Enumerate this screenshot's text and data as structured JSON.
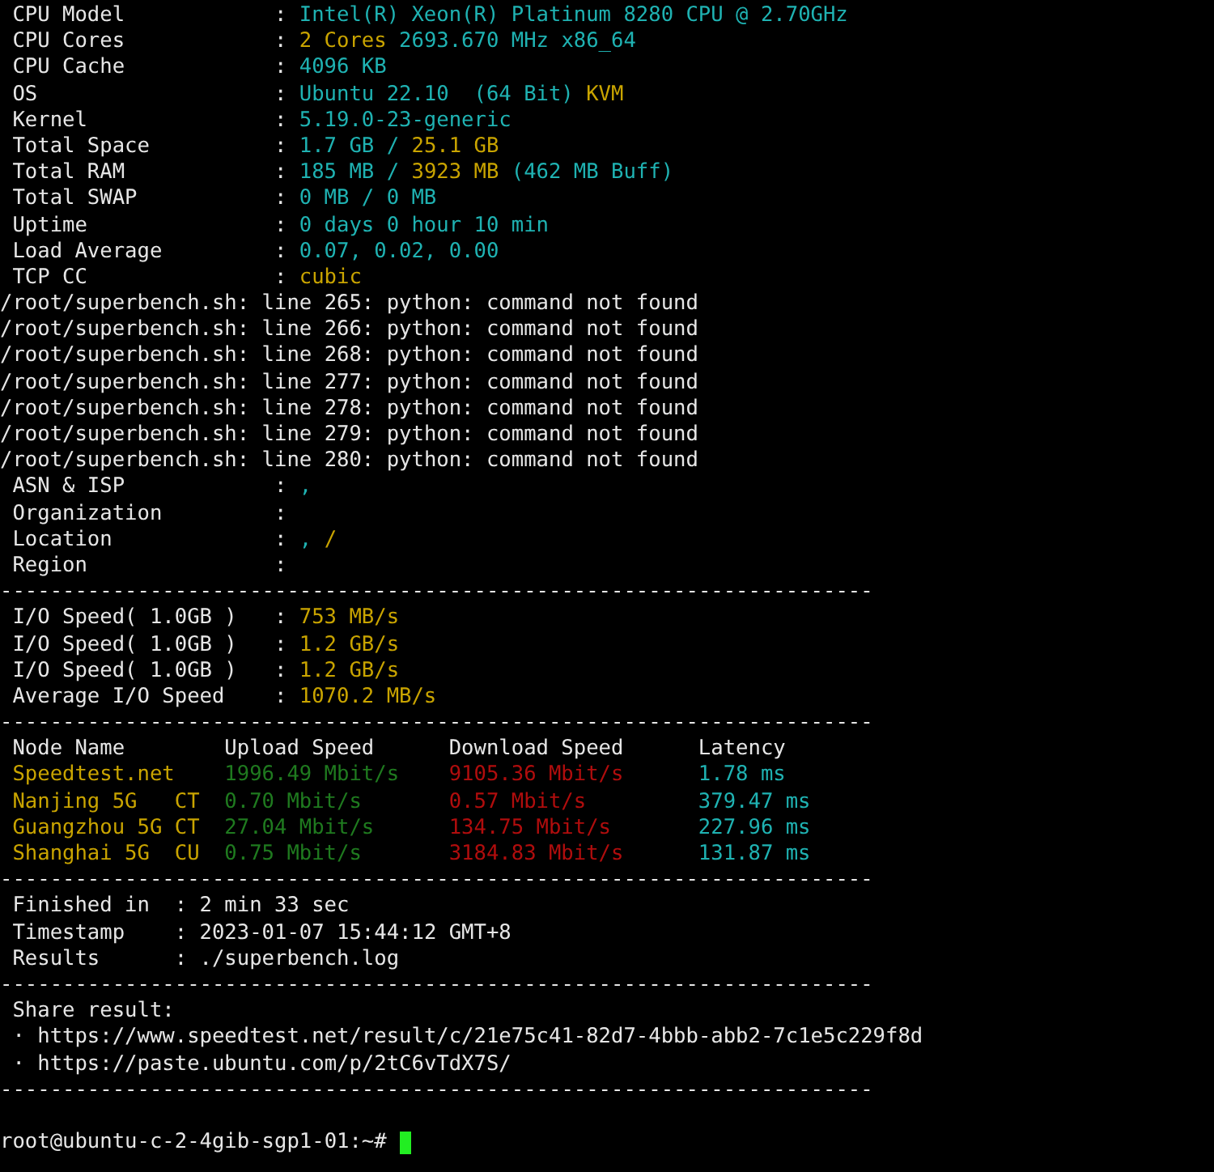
{
  "terminal": {
    "lines": [
      {
        "kind": "field",
        "label": "CPU Model",
        "sep": ":",
        "value": [
          {
            "text": "Intel(R) Xeon(R) Platinum 8280 CPU @ 2.70GHz",
            "color": "#1fb2b2"
          }
        ]
      },
      {
        "kind": "field",
        "label": "CPU Cores",
        "sep": ":",
        "value": [
          {
            "text": "2 Cores",
            "color": "#c9a400"
          },
          {
            "text": "2693.670 MHz x86_64",
            "color": "#1fb2b2"
          }
        ]
      },
      {
        "kind": "field",
        "label": "CPU Cache",
        "sep": ":",
        "value": [
          {
            "text": "4096 KB",
            "color": "#1fb2b2"
          }
        ]
      },
      {
        "kind": "field",
        "label": "OS",
        "sep": ":",
        "value": [
          {
            "text": "Ubuntu 22.10  (64 Bit)",
            "color": "#1fb2b2"
          },
          {
            "text": "KVM",
            "color": "#c9a400"
          }
        ]
      },
      {
        "kind": "field",
        "label": "Kernel",
        "sep": ":",
        "value": [
          {
            "text": "5.19.0-23-generic",
            "color": "#1fb2b2"
          }
        ]
      },
      {
        "kind": "field",
        "label": "Total Space",
        "sep": ":",
        "value": [
          {
            "text": "1.7 GB /",
            "color": "#1fb2b2"
          },
          {
            "text": "25.1 GB",
            "color": "#c9a400"
          }
        ]
      },
      {
        "kind": "field",
        "label": "Total RAM",
        "sep": ":",
        "value": [
          {
            "text": "185 MB /",
            "color": "#1fb2b2"
          },
          {
            "text": "3923 MB",
            "color": "#c9a400"
          },
          {
            "text": "(462 MB Buff)",
            "color": "#1fb2b2"
          }
        ]
      },
      {
        "kind": "field",
        "label": "Total SWAP",
        "sep": ":",
        "value": [
          {
            "text": "0 MB / 0 MB",
            "color": "#1fb2b2"
          }
        ]
      },
      {
        "kind": "field",
        "label": "Uptime",
        "sep": ":",
        "value": [
          {
            "text": "0 days 0 hour 10 min",
            "color": "#1fb2b2"
          }
        ]
      },
      {
        "kind": "field",
        "label": "Load Average",
        "sep": ":",
        "value": [
          {
            "text": "0.07, 0.02, 0.00",
            "color": "#1fb2b2"
          }
        ]
      },
      {
        "kind": "field",
        "label": "TCP CC",
        "sep": ":",
        "value": [
          {
            "text": "cubic",
            "color": "#c9a400"
          }
        ]
      },
      {
        "kind": "plain",
        "text": "/root/superbench.sh: line 265: python: command not found"
      },
      {
        "kind": "plain",
        "text": "/root/superbench.sh: line 266: python: command not found"
      },
      {
        "kind": "plain",
        "text": "/root/superbench.sh: line 268: python: command not found"
      },
      {
        "kind": "plain",
        "text": "/root/superbench.sh: line 277: python: command not found"
      },
      {
        "kind": "plain",
        "text": "/root/superbench.sh: line 278: python: command not found"
      },
      {
        "kind": "plain",
        "text": "/root/superbench.sh: line 279: python: command not found"
      },
      {
        "kind": "plain",
        "text": "/root/superbench.sh: line 280: python: command not found"
      },
      {
        "kind": "field",
        "label": "ASN & ISP",
        "sep": ":",
        "value": [
          {
            "text": ",",
            "color": "#1fb2b2"
          }
        ]
      },
      {
        "kind": "field",
        "label": "Organization",
        "sep": ":"
      },
      {
        "kind": "field",
        "label": "Location",
        "sep": ":",
        "value": [
          {
            "text": ",",
            "color": "#1fb2b2"
          },
          {
            "text": "/",
            "color": "#c9a400"
          }
        ]
      },
      {
        "kind": "field",
        "label": "Region",
        "sep": ":"
      },
      {
        "kind": "rule",
        "text": "----------------------------------------------------------------------"
      },
      {
        "kind": "field",
        "label": "I/O Speed( 1.0GB )",
        "sep": ":",
        "value": [
          {
            "text": "753 MB/s",
            "color": "#c9a400"
          }
        ]
      },
      {
        "kind": "field",
        "label": "I/O Speed( 1.0GB )",
        "sep": ":",
        "value": [
          {
            "text": "1.2 GB/s",
            "color": "#c9a400"
          }
        ]
      },
      {
        "kind": "field",
        "label": "I/O Speed( 1.0GB )",
        "sep": ":",
        "value": [
          {
            "text": "1.2 GB/s",
            "color": "#c9a400"
          }
        ]
      },
      {
        "kind": "field",
        "label": "Average I/O Speed",
        "sep": ":",
        "value": [
          {
            "text": "1070.2 MB/s",
            "color": "#c9a400"
          }
        ]
      },
      {
        "kind": "rule",
        "text": "----------------------------------------------------------------------"
      },
      {
        "kind": "speed_row",
        "cells": [
          {
            "text": "Node Name",
            "color": "#e6e6e6"
          },
          {
            "text": "Upload Speed",
            "color": "#e6e6e6"
          },
          {
            "text": "Download Speed",
            "color": "#e6e6e6"
          },
          {
            "text": "Latency",
            "color": "#e6e6e6"
          }
        ]
      },
      {
        "kind": "speed_row",
        "cells": [
          {
            "text": "Speedtest.net",
            "color": "#c9a400"
          },
          {
            "text": "1996.49 Mbit/s",
            "color": "#1f7a1f"
          },
          {
            "text": "9105.36 Mbit/s",
            "color": "#b00d0d"
          },
          {
            "text": "1.78 ms",
            "color": "#1fb2b2"
          }
        ]
      },
      {
        "kind": "speed_row",
        "cells": [
          {
            "text": "Nanjing 5G   CT",
            "color": "#c9a400"
          },
          {
            "text": "0.70 Mbit/s",
            "color": "#1f7a1f"
          },
          {
            "text": "0.57 Mbit/s",
            "color": "#b00d0d"
          },
          {
            "text": "379.47 ms",
            "color": "#1fb2b2"
          }
        ]
      },
      {
        "kind": "speed_row",
        "cells": [
          {
            "text": "Guangzhou 5G CT",
            "color": "#c9a400"
          },
          {
            "text": "27.04 Mbit/s",
            "color": "#1f7a1f"
          },
          {
            "text": "134.75 Mbit/s",
            "color": "#b00d0d"
          },
          {
            "text": "227.96 ms",
            "color": "#1fb2b2"
          }
        ]
      },
      {
        "kind": "speed_row",
        "cells": [
          {
            "text": "Shanghai 5G  CU",
            "color": "#c9a400"
          },
          {
            "text": "0.75 Mbit/s",
            "color": "#1f7a1f"
          },
          {
            "text": "3184.83 Mbit/s",
            "color": "#b00d0d"
          },
          {
            "text": "131.87 ms",
            "color": "#1fb2b2"
          }
        ]
      },
      {
        "kind": "rule",
        "text": "----------------------------------------------------------------------"
      },
      {
        "kind": "summary_field",
        "label": "Finished in",
        "sep": ":",
        "value": [
          {
            "text": "2 min 33 sec",
            "color": "#e6e6e6"
          }
        ]
      },
      {
        "kind": "summary_field",
        "label": "Timestamp",
        "sep": ":",
        "value": [
          {
            "text": "2023-01-07 15:44:12 GMT+8",
            "color": "#e6e6e6"
          }
        ]
      },
      {
        "kind": "summary_field",
        "label": "Results",
        "sep": ":",
        "value": [
          {
            "text": "./superbench.log",
            "color": "#e6e6e6"
          }
        ]
      },
      {
        "kind": "rule",
        "text": "----------------------------------------------------------------------"
      },
      {
        "kind": "note",
        "text": "Share result:"
      },
      {
        "kind": "note",
        "text": "· https://www.speedtest.net/result/c/21e75c41-82d7-4bbb-abb2-7c1e5c229f8d"
      },
      {
        "kind": "note",
        "text": "· https://paste.ubuntu.com/p/2tC6vTdX7S/"
      },
      {
        "kind": "rule",
        "text": "----------------------------------------------------------------------"
      },
      {
        "kind": "blank"
      },
      {
        "kind": "prompt",
        "text": "root@ubuntu-c-2-4gib-sgp1-01:~#"
      }
    ]
  }
}
